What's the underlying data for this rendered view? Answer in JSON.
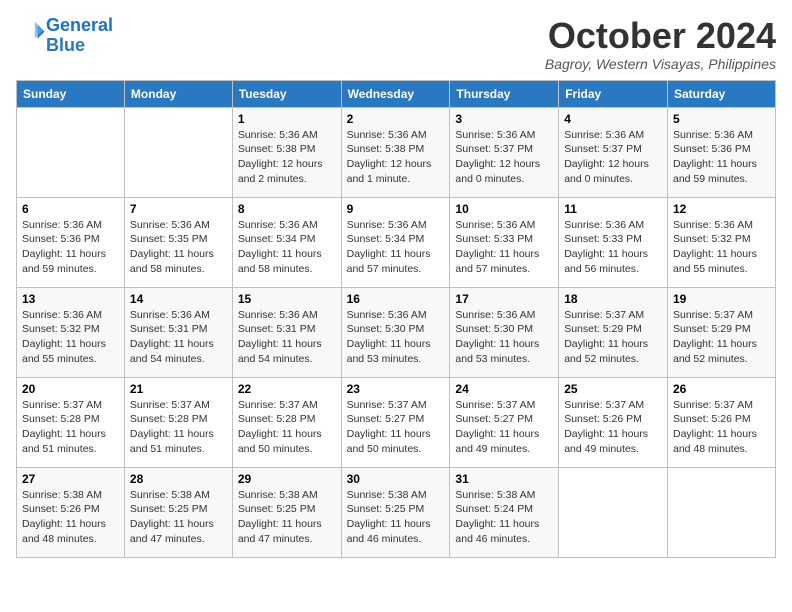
{
  "logo": {
    "line1": "General",
    "line2": "Blue"
  },
  "title": "October 2024",
  "location": "Bagroy, Western Visayas, Philippines",
  "days_header": [
    "Sunday",
    "Monday",
    "Tuesday",
    "Wednesday",
    "Thursday",
    "Friday",
    "Saturday"
  ],
  "weeks": [
    [
      {
        "day": "",
        "info": ""
      },
      {
        "day": "",
        "info": ""
      },
      {
        "day": "1",
        "info": "Sunrise: 5:36 AM\nSunset: 5:38 PM\nDaylight: 12 hours\nand 2 minutes."
      },
      {
        "day": "2",
        "info": "Sunrise: 5:36 AM\nSunset: 5:38 PM\nDaylight: 12 hours\nand 1 minute."
      },
      {
        "day": "3",
        "info": "Sunrise: 5:36 AM\nSunset: 5:37 PM\nDaylight: 12 hours\nand 0 minutes."
      },
      {
        "day": "4",
        "info": "Sunrise: 5:36 AM\nSunset: 5:37 PM\nDaylight: 12 hours\nand 0 minutes."
      },
      {
        "day": "5",
        "info": "Sunrise: 5:36 AM\nSunset: 5:36 PM\nDaylight: 11 hours\nand 59 minutes."
      }
    ],
    [
      {
        "day": "6",
        "info": "Sunrise: 5:36 AM\nSunset: 5:36 PM\nDaylight: 11 hours\nand 59 minutes."
      },
      {
        "day": "7",
        "info": "Sunrise: 5:36 AM\nSunset: 5:35 PM\nDaylight: 11 hours\nand 58 minutes."
      },
      {
        "day": "8",
        "info": "Sunrise: 5:36 AM\nSunset: 5:34 PM\nDaylight: 11 hours\nand 58 minutes."
      },
      {
        "day": "9",
        "info": "Sunrise: 5:36 AM\nSunset: 5:34 PM\nDaylight: 11 hours\nand 57 minutes."
      },
      {
        "day": "10",
        "info": "Sunrise: 5:36 AM\nSunset: 5:33 PM\nDaylight: 11 hours\nand 57 minutes."
      },
      {
        "day": "11",
        "info": "Sunrise: 5:36 AM\nSunset: 5:33 PM\nDaylight: 11 hours\nand 56 minutes."
      },
      {
        "day": "12",
        "info": "Sunrise: 5:36 AM\nSunset: 5:32 PM\nDaylight: 11 hours\nand 55 minutes."
      }
    ],
    [
      {
        "day": "13",
        "info": "Sunrise: 5:36 AM\nSunset: 5:32 PM\nDaylight: 11 hours\nand 55 minutes."
      },
      {
        "day": "14",
        "info": "Sunrise: 5:36 AM\nSunset: 5:31 PM\nDaylight: 11 hours\nand 54 minutes."
      },
      {
        "day": "15",
        "info": "Sunrise: 5:36 AM\nSunset: 5:31 PM\nDaylight: 11 hours\nand 54 minutes."
      },
      {
        "day": "16",
        "info": "Sunrise: 5:36 AM\nSunset: 5:30 PM\nDaylight: 11 hours\nand 53 minutes."
      },
      {
        "day": "17",
        "info": "Sunrise: 5:36 AM\nSunset: 5:30 PM\nDaylight: 11 hours\nand 53 minutes."
      },
      {
        "day": "18",
        "info": "Sunrise: 5:37 AM\nSunset: 5:29 PM\nDaylight: 11 hours\nand 52 minutes."
      },
      {
        "day": "19",
        "info": "Sunrise: 5:37 AM\nSunset: 5:29 PM\nDaylight: 11 hours\nand 52 minutes."
      }
    ],
    [
      {
        "day": "20",
        "info": "Sunrise: 5:37 AM\nSunset: 5:28 PM\nDaylight: 11 hours\nand 51 minutes."
      },
      {
        "day": "21",
        "info": "Sunrise: 5:37 AM\nSunset: 5:28 PM\nDaylight: 11 hours\nand 51 minutes."
      },
      {
        "day": "22",
        "info": "Sunrise: 5:37 AM\nSunset: 5:28 PM\nDaylight: 11 hours\nand 50 minutes."
      },
      {
        "day": "23",
        "info": "Sunrise: 5:37 AM\nSunset: 5:27 PM\nDaylight: 11 hours\nand 50 minutes."
      },
      {
        "day": "24",
        "info": "Sunrise: 5:37 AM\nSunset: 5:27 PM\nDaylight: 11 hours\nand 49 minutes."
      },
      {
        "day": "25",
        "info": "Sunrise: 5:37 AM\nSunset: 5:26 PM\nDaylight: 11 hours\nand 49 minutes."
      },
      {
        "day": "26",
        "info": "Sunrise: 5:37 AM\nSunset: 5:26 PM\nDaylight: 11 hours\nand 48 minutes."
      }
    ],
    [
      {
        "day": "27",
        "info": "Sunrise: 5:38 AM\nSunset: 5:26 PM\nDaylight: 11 hours\nand 48 minutes."
      },
      {
        "day": "28",
        "info": "Sunrise: 5:38 AM\nSunset: 5:25 PM\nDaylight: 11 hours\nand 47 minutes."
      },
      {
        "day": "29",
        "info": "Sunrise: 5:38 AM\nSunset: 5:25 PM\nDaylight: 11 hours\nand 47 minutes."
      },
      {
        "day": "30",
        "info": "Sunrise: 5:38 AM\nSunset: 5:25 PM\nDaylight: 11 hours\nand 46 minutes."
      },
      {
        "day": "31",
        "info": "Sunrise: 5:38 AM\nSunset: 5:24 PM\nDaylight: 11 hours\nand 46 minutes."
      },
      {
        "day": "",
        "info": ""
      },
      {
        "day": "",
        "info": ""
      }
    ]
  ]
}
